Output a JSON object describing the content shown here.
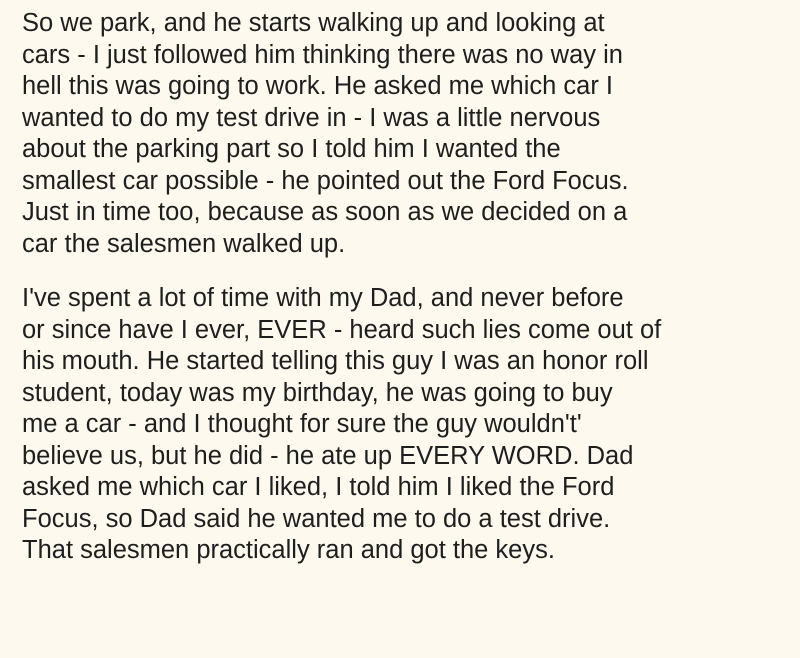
{
  "paragraphs": [
    {
      "lines": [
        "So we park, and he starts walking up and looking at",
        "cars - I just followed him thinking there was no way in",
        "hell this was going to work. He asked me which car I",
        "wanted to do my test drive in - I was a little nervous",
        "about the parking part so I told him I wanted the",
        "smallest car possible - he pointed out the Ford Focus.",
        "Just in time too, because as soon as we decided on a",
        "car the salesmen walked up."
      ]
    },
    {
      "lines": [
        "I've spent a lot of time with my Dad, and never before",
        "or since have I ever, EVER - heard such lies come out of",
        "his mouth. He started telling this guy I was an honor roll",
        "student, today was my birthday, he was going to buy",
        "me a car - and I thought for sure the guy wouldn't'",
        "believe us, but he did - he ate up EVERY WORD. Dad",
        "asked me which car I liked, I told him I liked the Ford",
        "Focus, so Dad said he wanted me to do a test drive.",
        "That salesmen practically ran and got the keys."
      ]
    }
  ]
}
